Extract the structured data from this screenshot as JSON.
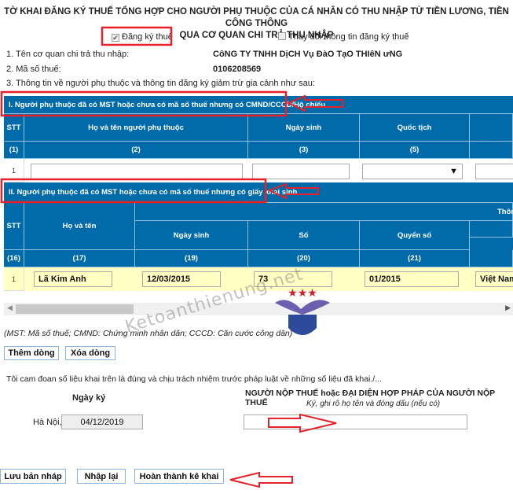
{
  "title_line1": "TỜ KHAI ĐĂNG KÝ THUẾ TỔNG HỢP CHO NGƯỜI PHỤ THUỘC CỦA CÁ NHÂN CÓ THU NHẬP TỪ TIỀN LƯƠNG, TIỀN CÔNG THÔNG",
  "title_line2": "QUA CƠ QUAN CHI TRẢ THU NHẬP",
  "options": {
    "register": {
      "label": "Đăng ký thuế",
      "checked": true
    },
    "change": {
      "label": "Thay đổi thông tin đăng ký thuế",
      "checked": false
    }
  },
  "info": {
    "payer_label": "1. Tên cơ quan chi trả thu nhập:",
    "payer_value": "CôNG TY TNHH DịCH Vụ ĐàO TạO THIêN ưNG",
    "tax_label": "2. Mã số thuế:",
    "tax_value": "0106208569",
    "dep_label": "3. Thông tin về người phụ thuộc và thông tin đăng ký giảm trừ gia cảnh như sau:"
  },
  "section1": {
    "title": "I. Người phụ thuộc đã có MST hoặc chưa có mã số thuế nhưng có CMND/CCCD/Hộ chiếu",
    "headers": [
      "STT",
      "Họ và tên người phụ thuộc",
      "Ngày sinh",
      "Quốc tịch"
    ],
    "numbers": [
      "(1)",
      "(2)",
      "(3)",
      "(5)"
    ],
    "rows": [
      {
        "stt": "1",
        "name": "",
        "dob": "",
        "nationality": ""
      }
    ]
  },
  "section2": {
    "title": "II. Người phụ thuộc đã có MST hoặc chưa có mã số thuế nhưng có giấy khai sinh",
    "group_header": "Thông",
    "headers": [
      "STT",
      "Họ và tên",
      "Ngày sinh",
      "Số",
      "Quyển số"
    ],
    "numbers": [
      "(16)",
      "(17)",
      "(19)",
      "(20)",
      "(21)"
    ],
    "rows": [
      {
        "stt": "1",
        "name": "Lã Kim Anh",
        "dob": "12/03/2015",
        "so": "73",
        "quyen_so": "01/2015",
        "nationality": "Việt Nam"
      }
    ]
  },
  "note": "(MST: Mã số thuế; CMND: Chứng minh nhân dân; CCCD: Căn cước công dân)",
  "row_buttons": {
    "add": "Thêm dòng",
    "delete": "Xóa dòng"
  },
  "commitment": "Tôi cam đoan số liệu khai trên là đúng và chịu trách nhiệm trước pháp luật về những số liệu đã khai./...",
  "sign": {
    "date_label": "Ngày ký",
    "place": "Hà Nội,",
    "date": "04/12/2019",
    "signer_title": "NGƯỜI NỘP THUẾ hoặc ĐẠI DIỆN HỢP PHÁP CỦA NGƯỜI NỘP THUẾ",
    "signer_hint": "Ký, ghi rõ họ tên và đóng dấu (nếu có)",
    "signer_value": ""
  },
  "footer_buttons": {
    "save_draft": "Lưu bản nháp",
    "reset": "Nhập lại",
    "complete": "Hoàn thành kê khai"
  },
  "watermark": "Ketoanthienung.net",
  "colors": {
    "table_header": "#006ba8",
    "highlight_row": "#ffffc4",
    "annotation": "#e8202a"
  }
}
